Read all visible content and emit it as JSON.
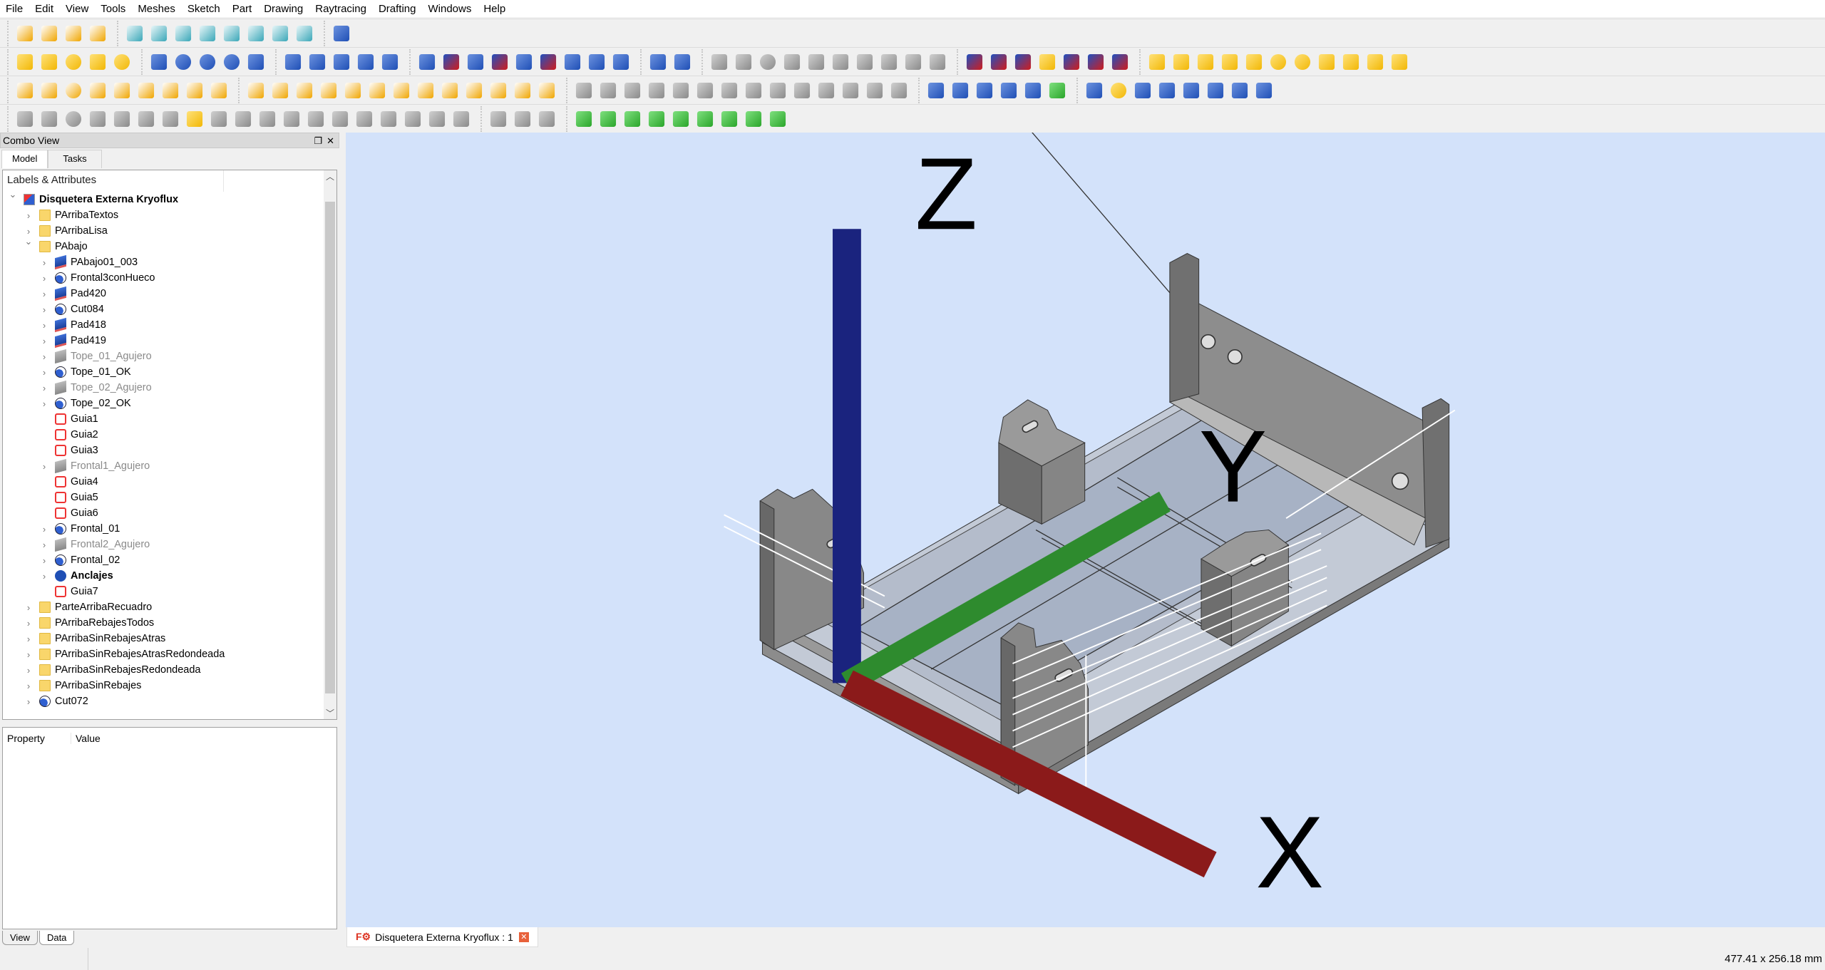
{
  "menu": [
    "File",
    "Edit",
    "View",
    "Tools",
    "Meshes",
    "Sketch",
    "Part",
    "Drawing",
    "Raytracing",
    "Drafting",
    "Windows",
    "Help"
  ],
  "toolbars": [
    [
      [
        "new-document-icon",
        "a3-page-icon",
        "import-icon",
        "save-icon"
      ],
      [
        "fit-all-icon",
        "isometric-view-icon",
        "front-view-icon",
        "top-view-icon",
        "right-view-icon",
        "rear-view-icon",
        "bottom-view-icon",
        "left-view-icon"
      ],
      [
        "measure-icon"
      ]
    ],
    [
      [
        "box-icon",
        "cylinder-icon",
        "sphere-icon",
        "cone-icon",
        "torus-icon"
      ],
      [
        "union-icon",
        "cut-icon",
        "fuse-icon",
        "common-icon",
        "shell-icon"
      ],
      [
        "extrude-icon",
        "revolve-icon",
        "mirror-icon",
        "fillet-icon",
        "chamfer-icon"
      ],
      [
        "pad-icon",
        "pocket-icon",
        "revolution-icon",
        "groove-icon",
        "additive-loft-icon",
        "subtractive-loft-icon",
        "pattern-icon",
        "multi-pattern-icon",
        "shape-binder-icon"
      ],
      [
        "new-sketch-icon",
        "export-icon"
      ],
      [
        "point-icon",
        "line-icon",
        "circle-icon",
        "arc-icon",
        "polyline-icon",
        "rectangle-icon",
        "slot-icon",
        "trim-icon",
        "extend-icon",
        "split-icon"
      ],
      [
        "raytrace-box-icon",
        "raytrace-pocket-icon",
        "raytrace-shape-icon",
        "raytrace-cylinder-icon",
        "raytrace-fillet-icon",
        "raytrace-lego-icon",
        "raytrace-pattern-icon"
      ],
      [
        "primitive-box-icon",
        "primitive-tube-icon",
        "primitive-cone-icon",
        "primitive-cylinder-icon",
        "primitive-cylinder2-icon",
        "primitive-sphere-icon",
        "primitive-torus-icon",
        "primitive-wedge-icon",
        "primitive-helix-icon",
        "primitive-plane-icon",
        "primitive-face-icon"
      ]
    ],
    [
      [
        "draft-line-icon",
        "draft-wire-icon",
        "draft-circle-icon",
        "draft-arc-icon",
        "draft-rectangle-icon",
        "draft-polygon-icon",
        "draft-bspline-icon",
        "draft-text-icon",
        "draft-dimension-icon"
      ],
      [
        "draft-move-icon",
        "draft-rotate-icon",
        "draft-offset-icon",
        "draft-stretch-icon",
        "draft-upgrade-icon",
        "draft-downgrade-icon",
        "draft-scale-icon",
        "draft-edit-icon",
        "draft-shape2d-icon",
        "draft-wire-to-spline-icon",
        "draft-add-point-icon",
        "draft-del-point-icon",
        "draft-facebinder-icon"
      ],
      [
        "constraint-point-icon",
        "constraint-fillet-icon",
        "constraint-vertical-icon",
        "constraint-horizontal-icon",
        "constraint-parallel-icon",
        "constraint-perpendicular-icon",
        "constraint-tangent-icon",
        "constraint-equal-icon",
        "constraint-symmetric-icon",
        "constraint-lock-icon",
        "constraint-distance-x-icon",
        "constraint-distance-y-icon",
        "constraint-distance-icon",
        "constraint-angle-icon"
      ],
      [
        "sync-icon",
        "attach-icon",
        "clone-icon",
        "material-icon",
        "snap-icon",
        "green-arrow-icon"
      ],
      [
        "section-icon",
        "shape-sphere-icon",
        "shape-white-icon",
        "shape-gray-icon",
        "sweep-icon",
        "loft-icon",
        "check-geometry-icon",
        "compound-icon"
      ]
    ],
    [
      [
        "sketch-arc-icon",
        "sketch-line-icon",
        "sketch-circle-icon",
        "sketch-arc3-icon",
        "sketch-bspline-icon",
        "sketch-ellipse-icon",
        "sketch-ellipse2-icon",
        "sketch-cone-icon",
        "sketch-fillet-icon",
        "sketch-hexagon-icon",
        "sketch-heptagon-icon",
        "sketch-line2-icon",
        "sketch-octagon-icon",
        "sketch-pentagon-icon",
        "sketch-polyline-icon",
        "sketch-square-icon",
        "sketch-slot-icon",
        "sketch-external-icon",
        "sketch-triangle-icon"
      ],
      [
        "sketch-trim-icon",
        "sketch-extend-icon",
        "sketch-split-icon"
      ],
      [
        "mesh-green-icon",
        "mesh-cursor-icon",
        "mesh-arrow-icon",
        "mesh-cube-icon",
        "mesh-vertex-icon",
        "mesh-green2-icon",
        "mesh-fill-icon",
        "mesh-curve-icon",
        "mesh-remove-icon"
      ]
    ]
  ],
  "combo_view": {
    "title": "Combo View",
    "tabs": [
      "Model",
      "Tasks"
    ],
    "tree_header": "Labels & Attributes"
  },
  "tree": [
    {
      "label": "Disquetera Externa Kryoflux",
      "level": 0,
      "icon": "document-icon",
      "chevron": "down",
      "bold": true
    },
    {
      "label": "PArribaTextos",
      "level": 1,
      "icon": "folder-icon",
      "chevron": "right"
    },
    {
      "label": "PArribaLisa",
      "level": 1,
      "icon": "folder-icon",
      "chevron": "right"
    },
    {
      "label": "PAbajo",
      "level": 1,
      "icon": "folder-icon",
      "chevron": "down"
    },
    {
      "label": "PAbajo01_003",
      "level": 2,
      "icon": "pad-icon",
      "chevron": "right"
    },
    {
      "label": "Frontal3conHueco",
      "level": 2,
      "icon": "cut-icon",
      "chevron": "right"
    },
    {
      "label": "Pad420",
      "level": 2,
      "icon": "pad-icon",
      "chevron": "right"
    },
    {
      "label": "Cut084",
      "level": 2,
      "icon": "cut-icon",
      "chevron": "right"
    },
    {
      "label": "Pad418",
      "level": 2,
      "icon": "pad-icon",
      "chevron": "right"
    },
    {
      "label": "Pad419",
      "level": 2,
      "icon": "pad-icon",
      "chevron": "right"
    },
    {
      "label": "Tope_01_Agujero",
      "level": 2,
      "icon": "hidden-pad-icon",
      "chevron": "right",
      "hidden": true
    },
    {
      "label": "Tope_01_OK",
      "level": 2,
      "icon": "cut-icon",
      "chevron": "right"
    },
    {
      "label": "Tope_02_Agujero",
      "level": 2,
      "icon": "hidden-pad-icon",
      "chevron": "right",
      "hidden": true
    },
    {
      "label": "Tope_02_OK",
      "level": 2,
      "icon": "cut-icon",
      "chevron": "right"
    },
    {
      "label": "Guia1",
      "level": 2,
      "icon": "sketch-icon"
    },
    {
      "label": "Guia2",
      "level": 2,
      "icon": "sketch-icon"
    },
    {
      "label": "Guia3",
      "level": 2,
      "icon": "sketch-icon"
    },
    {
      "label": "Frontal1_Agujero",
      "level": 2,
      "icon": "hidden-pad-icon",
      "chevron": "right",
      "hidden": true
    },
    {
      "label": "Guia4",
      "level": 2,
      "icon": "sketch-icon"
    },
    {
      "label": "Guia5",
      "level": 2,
      "icon": "sketch-icon"
    },
    {
      "label": "Guia6",
      "level": 2,
      "icon": "sketch-icon"
    },
    {
      "label": "Frontal_01",
      "level": 2,
      "icon": "cut-icon",
      "chevron": "right"
    },
    {
      "label": "Frontal2_Agujero",
      "level": 2,
      "icon": "hidden-pad-icon",
      "chevron": "right",
      "hidden": true
    },
    {
      "label": "Frontal_02",
      "level": 2,
      "icon": "cut-icon",
      "chevron": "right"
    },
    {
      "label": "Anclajes",
      "level": 2,
      "icon": "fuse-icon",
      "chevron": "right",
      "bold": true
    },
    {
      "label": "Guia7",
      "level": 2,
      "icon": "sketch-icon"
    },
    {
      "label": "ParteArribaRecuadro",
      "level": 1,
      "icon": "folder-icon",
      "chevron": "right"
    },
    {
      "label": "PArribaRebajesTodos",
      "level": 1,
      "icon": "folder-icon",
      "chevron": "right"
    },
    {
      "label": "PArribaSinRebajesAtras",
      "level": 1,
      "icon": "folder-icon",
      "chevron": "right"
    },
    {
      "label": "PArribaSinRebajesAtrasRedondeada",
      "level": 1,
      "icon": "folder-icon",
      "chevron": "right"
    },
    {
      "label": "PArribaSinRebajesRedondeada",
      "level": 1,
      "icon": "folder-icon",
      "chevron": "right"
    },
    {
      "label": "PArribaSinRebajes",
      "level": 1,
      "icon": "folder-icon",
      "chevron": "right"
    },
    {
      "label": "Cut072",
      "level": 1,
      "icon": "cut-icon",
      "chevron": "right"
    }
  ],
  "property_panel": {
    "col_property": "Property",
    "col_value": "Value",
    "tabs": [
      "View",
      "Data"
    ]
  },
  "document_tab": {
    "label": "Disquetera Externa Kryoflux : 1"
  },
  "axes": {
    "x": "X",
    "y": "Y",
    "z": "Z"
  },
  "status": {
    "dimensions": "477.41 x 256.18 mm"
  },
  "colors": {
    "viewport_bg": "#d3e2fa",
    "model_gray": "#8a8a8a",
    "axis_x": "#8b1a1a",
    "axis_y": "#2e8b2e",
    "axis_z": "#1a237e"
  }
}
